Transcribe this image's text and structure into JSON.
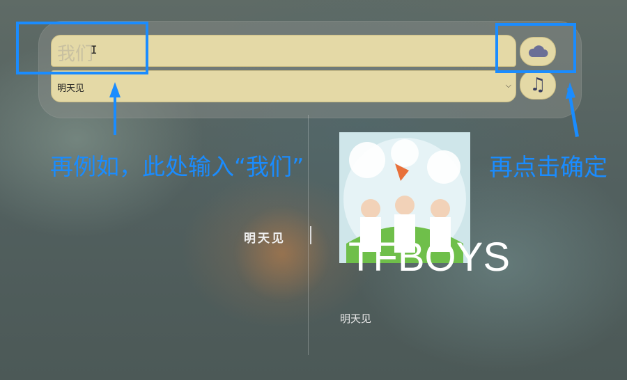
{
  "search": {
    "value": "我们",
    "placeholder": ""
  },
  "song_select": {
    "selected": "明天见"
  },
  "buttons": {
    "cloud_icon": "cloud-icon",
    "music_icon": "music-note-icon",
    "music_glyph": "♫"
  },
  "annotations": {
    "left_text": "再例如，此处输入“我们”",
    "right_text": "再点击确定",
    "color": "#1a8cff"
  },
  "player": {
    "song_title": "明天见",
    "artist": "TFBOYS",
    "song_title_under": "明天见"
  },
  "colors": {
    "field_bg": "#e4d9a6",
    "icon": "#6b6f96"
  }
}
